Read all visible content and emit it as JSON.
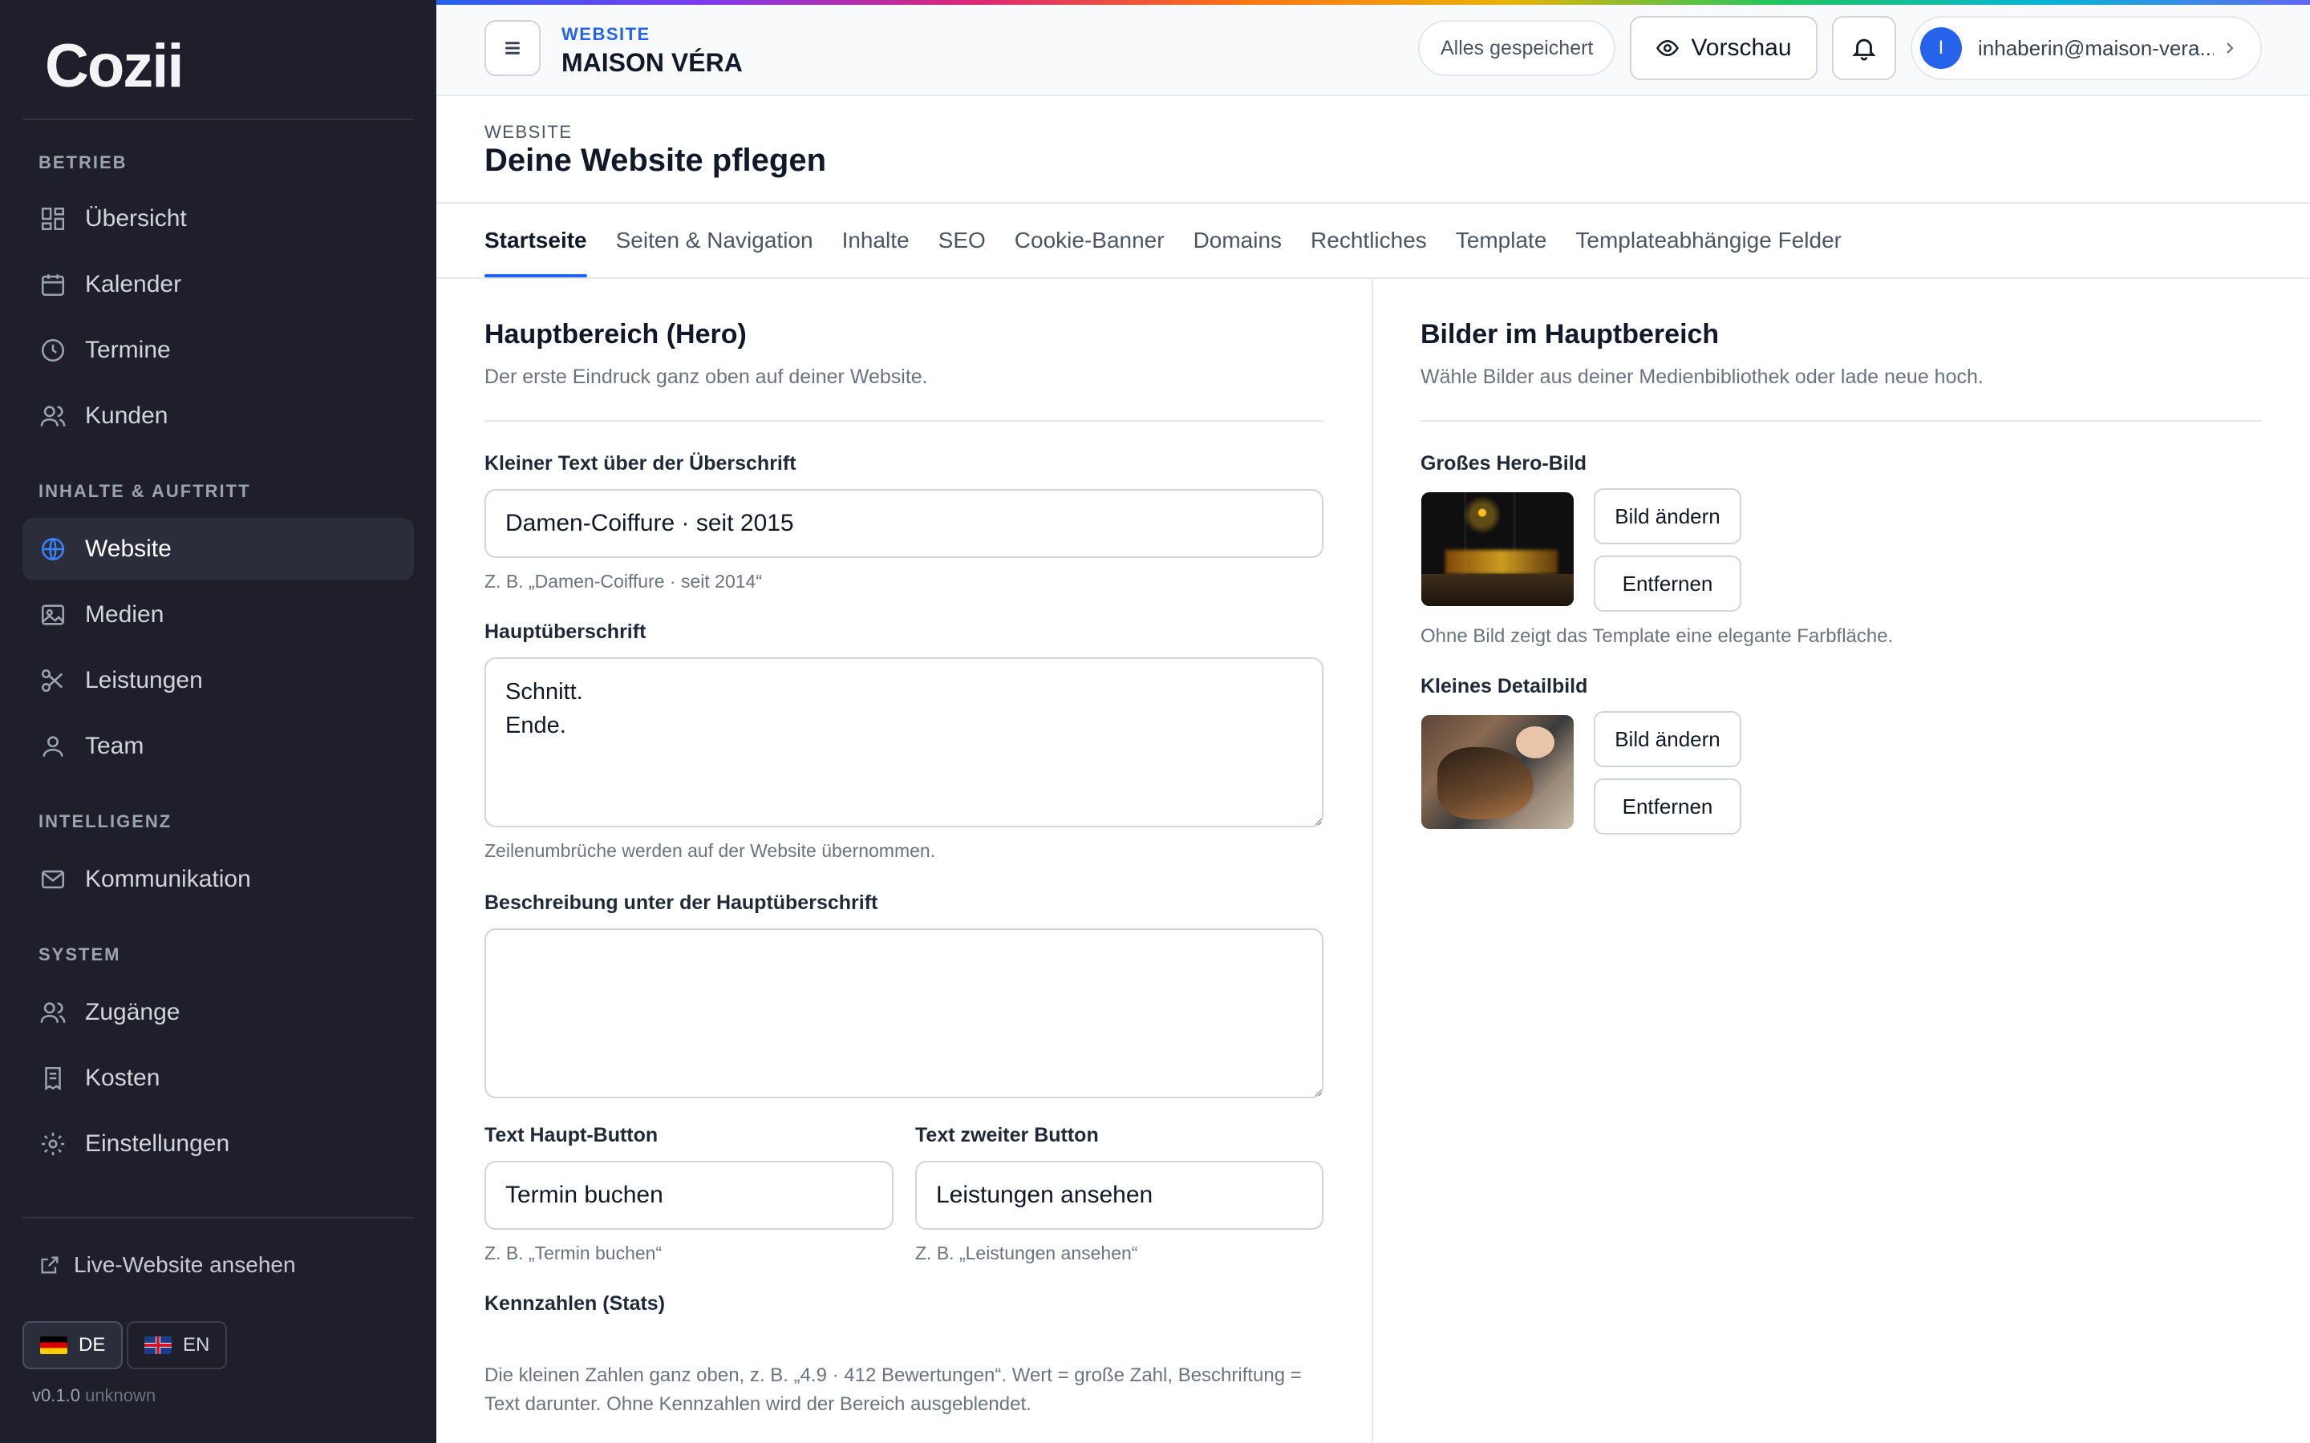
{
  "brand": {
    "logo_text": "Cozii"
  },
  "sidebar": {
    "sections": [
      {
        "title": "BETRIEB"
      },
      {
        "title": "INHALTE & AUFTRITT"
      },
      {
        "title": "INTELLIGENZ"
      },
      {
        "title": "SYSTEM"
      }
    ],
    "items": [
      {
        "label": "Übersicht",
        "icon": "dashboard-icon"
      },
      {
        "label": "Kalender",
        "icon": "calendar-icon"
      },
      {
        "label": "Termine",
        "icon": "clock-icon"
      },
      {
        "label": "Kunden",
        "icon": "users-icon"
      },
      {
        "label": "Website",
        "icon": "globe-icon",
        "active": true
      },
      {
        "label": "Medien",
        "icon": "image-icon"
      },
      {
        "label": "Leistungen",
        "icon": "scissors-icon"
      },
      {
        "label": "Team",
        "icon": "user-icon"
      },
      {
        "label": "Kommunikation",
        "icon": "mail-icon"
      },
      {
        "label": "Zugänge",
        "icon": "users-icon"
      },
      {
        "label": "Kosten",
        "icon": "receipt-icon"
      },
      {
        "label": "Einstellungen",
        "icon": "gear-icon"
      }
    ],
    "live_link": "Live-Website ansehen",
    "languages": [
      {
        "code": "DE",
        "active": true
      },
      {
        "code": "EN",
        "active": false
      }
    ],
    "version": "v0.1.0",
    "version_suffix": "unknown"
  },
  "topbar": {
    "kicker": "WEBSITE",
    "site_name": "MAISON VÉRA",
    "saved_status": "Alles gespeichert",
    "preview_label": "Vorschau",
    "user_initial": "I",
    "user_email": "inhaberin@maison-vera...."
  },
  "page": {
    "kicker": "WEBSITE",
    "title": "Deine Website pflegen"
  },
  "tabs": [
    {
      "label": "Startseite",
      "active": true
    },
    {
      "label": "Seiten & Navigation"
    },
    {
      "label": "Inhalte"
    },
    {
      "label": "SEO"
    },
    {
      "label": "Cookie-Banner"
    },
    {
      "label": "Domains"
    },
    {
      "label": "Rechtliches"
    },
    {
      "label": "Template"
    },
    {
      "label": "Templateabhängige Felder"
    }
  ],
  "hero": {
    "title": "Hauptbereich (Hero)",
    "description": "Der erste Eindruck ganz oben auf deiner Website.",
    "kicker_label": "Kleiner Text über der Überschrift",
    "kicker_value": "Damen-Coiffure · seit 2015",
    "kicker_hint": "Z. B. „Damen-Coiffure · seit 2014“",
    "heading_label": "Hauptüberschrift",
    "heading_value": "Schnitt.\nEnde.",
    "heading_hint": "Zeilenumbrüche werden auf der Website übernommen.",
    "description_label": "Beschreibung unter der Hauptüberschrift",
    "description_value": "",
    "primary_button_label": "Text Haupt-Button",
    "primary_button_value": "Termin buchen",
    "primary_button_hint": "Z. B. „Termin buchen“",
    "secondary_button_label": "Text zweiter Button",
    "secondary_button_value": "Leistungen ansehen",
    "secondary_button_hint": "Z. B. „Leistungen ansehen“",
    "stats_label": "Kennzahlen (Stats)",
    "stats_hint": "Die kleinen Zahlen ganz oben, z. B. „4.9 · 412 Bewertungen“. Wert = große Zahl, Beschriftung = Text darunter. Ohne Kennzahlen wird der Bereich ausgeblendet."
  },
  "images": {
    "title": "Bilder im Hauptbereich",
    "description": "Wähle Bilder aus deiner Medienbibliothek oder lade neue hoch.",
    "hero_label": "Großes Hero-Bild",
    "hero_hint": "Ohne Bild zeigt das Template eine elegante Farbfläche.",
    "detail_label": "Kleines Detailbild",
    "change_label": "Bild ändern",
    "remove_label": "Entfernen"
  }
}
